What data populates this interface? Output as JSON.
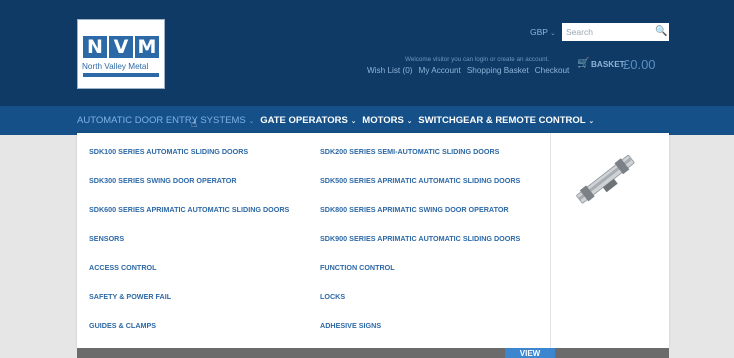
{
  "logo": {
    "letters": [
      "N",
      "V",
      "M"
    ],
    "text": "North Valley Metal"
  },
  "header": {
    "currency": "GBP",
    "search_placeholder": "Search",
    "welcome": "Welcome visitor you can login or create an account.",
    "links": [
      "Wish List (0)",
      "My Account",
      "Shopping Basket",
      "Checkout"
    ],
    "basket_label": "BASKET",
    "basket_total": "£0.00"
  },
  "nav": {
    "items": [
      {
        "label": "AUTOMATIC DOOR ENTRY SYSTEMS"
      },
      {
        "label": "GATE OPERATORS"
      },
      {
        "label": "MOTORS"
      },
      {
        "label": "SWITCHGEAR & REMOTE CONTROL"
      }
    ]
  },
  "mega": {
    "col1": [
      "SDK100 SERIES AUTOMATIC SLIDING DOORS",
      "SDK300 SERIES SWING DOOR OPERATOR",
      "SDK600 SERIES APRIMATIC AUTOMATIC SLIDING DOORS",
      "SENSORS",
      "ACCESS CONTROL",
      "SAFETY & POWER FAIL",
      "GUIDES & CLAMPS"
    ],
    "col2": [
      "SDK200 SERIES SEMI-AUTOMATIC SLIDING DOORS",
      "SDK500 SERIES APRIMATIC AUTOMATIC SLIDING DOORS",
      "SDK800 SERIES APRIMATIC SWING DOOR OPERATOR",
      "SDK900 SERIES APRIMATIC AUTOMATIC SLIDING DOORS",
      "FUNCTION CONTROL",
      "LOCKS",
      "ADHESIVE SIGNS"
    ]
  },
  "banner": {
    "view_label": "VIEW"
  },
  "colors": {
    "header_bg": "#0f3a66",
    "nav_bg": "#155089",
    "accent": "#2d69a6"
  }
}
